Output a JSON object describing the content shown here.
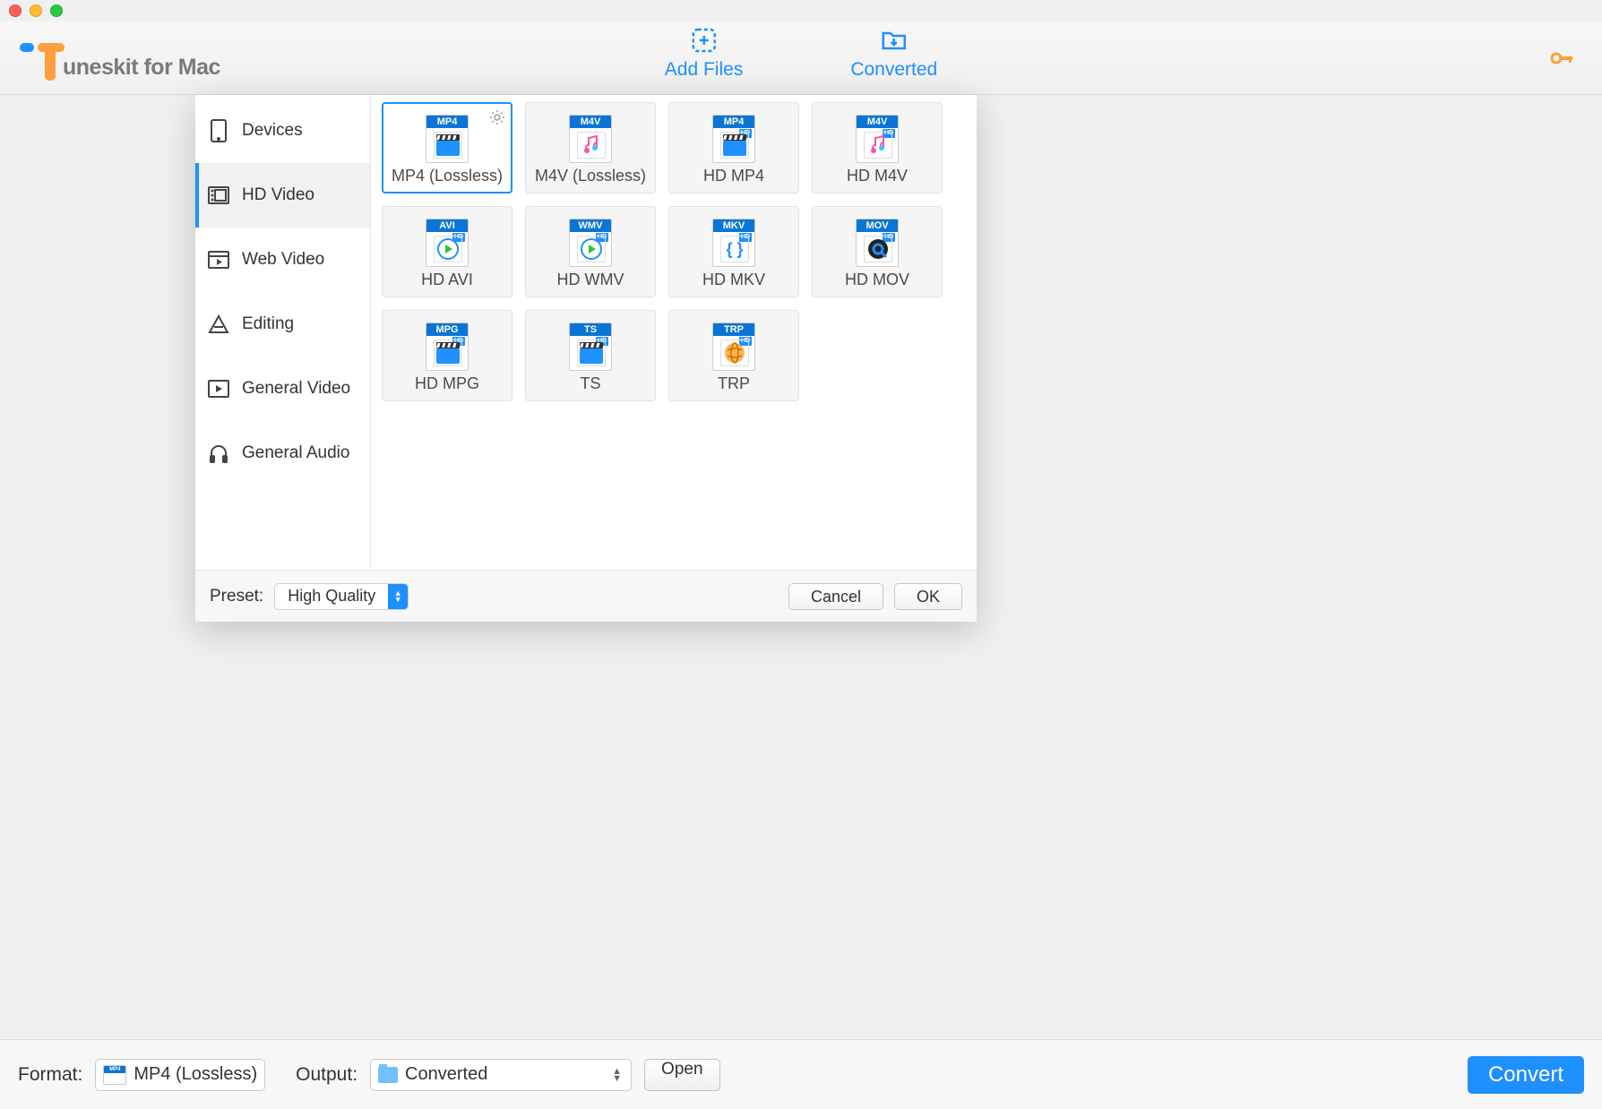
{
  "logo": {
    "text": "uneskit for Mac"
  },
  "header": {
    "add_files": "Add Files",
    "converted": "Converted"
  },
  "modal": {
    "sidebar": {
      "items": [
        {
          "label": "Devices"
        },
        {
          "label": "HD Video"
        },
        {
          "label": "Web Video"
        },
        {
          "label": "Editing"
        },
        {
          "label": "General Video"
        },
        {
          "label": "General Audio"
        }
      ]
    },
    "formats": [
      {
        "tag": "MP4",
        "label": "MP4 (Lossless)",
        "hd": false,
        "selected": true,
        "glyph": "clapper"
      },
      {
        "tag": "M4V",
        "label": "M4V (Lossless)",
        "hd": false,
        "glyph": "note"
      },
      {
        "tag": "MP4",
        "label": "HD MP4",
        "hd": true,
        "glyph": "clapper"
      },
      {
        "tag": "M4V",
        "label": "HD M4V",
        "hd": true,
        "glyph": "note"
      },
      {
        "tag": "AVI",
        "label": "HD AVI",
        "hd": true,
        "glyph": "disc"
      },
      {
        "tag": "WMV",
        "label": "HD WMV",
        "hd": true,
        "glyph": "disc"
      },
      {
        "tag": "MKV",
        "label": "HD MKV",
        "hd": true,
        "glyph": "braces"
      },
      {
        "tag": "MOV",
        "label": "HD MOV",
        "hd": true,
        "glyph": "quicktime"
      },
      {
        "tag": "MPG",
        "label": "HD MPG",
        "hd": true,
        "glyph": "clapper"
      },
      {
        "tag": "TS",
        "label": "TS",
        "hd": true,
        "glyph": "clapper"
      },
      {
        "tag": "TRP",
        "label": "TRP",
        "hd": true,
        "glyph": "globe"
      }
    ],
    "footer": {
      "preset_label": "Preset:",
      "preset_value": "High Quality",
      "cancel": "Cancel",
      "ok": "OK"
    }
  },
  "bottombar": {
    "format_label": "Format:",
    "format_value": "MP4 (Lossless)",
    "output_label": "Output:",
    "output_value": "Converted",
    "open": "Open",
    "convert": "Convert"
  }
}
